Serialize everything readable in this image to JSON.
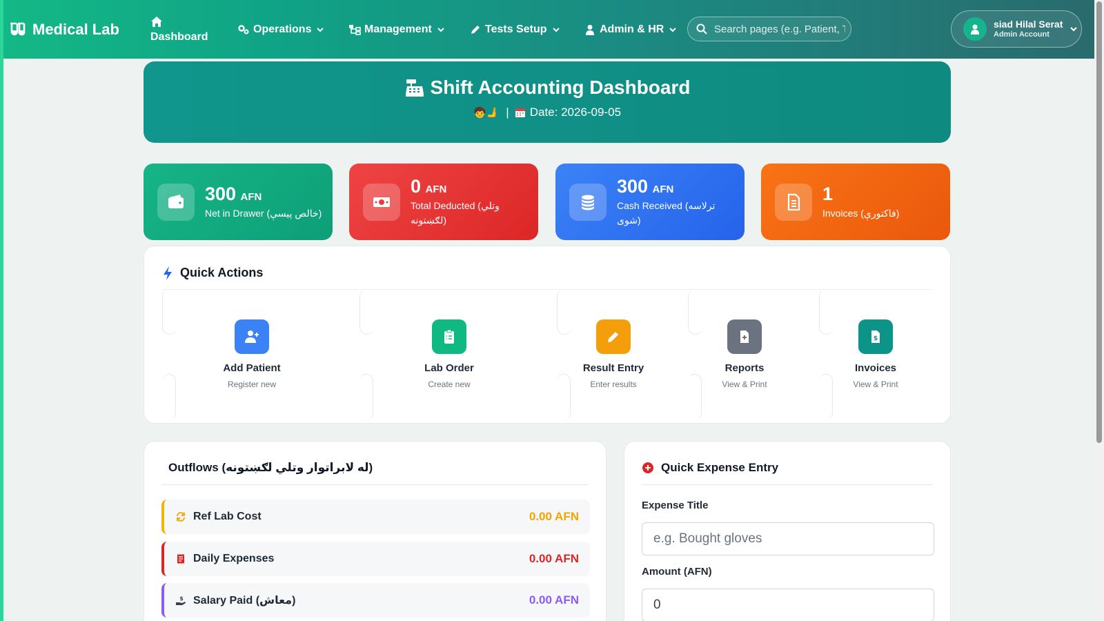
{
  "nav": {
    "brand": "Medical Lab",
    "home_label": "Dashboard",
    "items": [
      {
        "label": "Operations",
        "icon": "gears-icon"
      },
      {
        "label": "Management",
        "icon": "sitemap-icon"
      },
      {
        "label": "Tests Setup",
        "icon": "pen-icon"
      },
      {
        "label": "Admin & HR",
        "icon": "user-tie-icon"
      }
    ],
    "search_placeholder": "Search pages (e.g. Patient, T",
    "user": {
      "name": "siad Hilal Serat",
      "role": "Admin Account"
    }
  },
  "banner": {
    "title": "Shift Accounting Dashboard",
    "emoji": "🧒🫸",
    "separator": "|",
    "date": "Date: 2026-09-05"
  },
  "stats": [
    {
      "value": "300",
      "unit": "AFN",
      "label": "Net in Drawer (خالص پیسې)",
      "color": "#16b486",
      "icon": "wallet-icon"
    },
    {
      "value": "0",
      "unit": "AFN",
      "label": "Total Deducted (وتلي لګښتونه)",
      "color": "#ef4444",
      "icon": "money-bill-icon"
    },
    {
      "value": "300",
      "unit": "AFN",
      "label": "Cash Received (ترلاسه شوی)",
      "color": "#3b82f6",
      "icon": "coins-icon"
    },
    {
      "value": "1",
      "unit": "",
      "label": "Invoices (فاکتورې)",
      "color": "#f97316",
      "icon": "file-invoice-icon"
    }
  ],
  "quick_actions": {
    "title": "Quick Actions",
    "items": [
      {
        "title": "Add Patient",
        "sub": "Register new",
        "color": "#3b82f6",
        "icon": "user-plus-icon"
      },
      {
        "title": "Lab Order",
        "sub": "Create new",
        "color": "#10b981",
        "icon": "clipboard-list-icon"
      },
      {
        "title": "Result Entry",
        "sub": "Enter results",
        "color": "#f59e0b",
        "icon": "pen-icon"
      },
      {
        "title": "Reports",
        "sub": "View & Print",
        "color": "#6b7280",
        "icon": "file-medical-icon"
      },
      {
        "title": "Invoices",
        "sub": "View & Print",
        "color": "#0d9488",
        "icon": "file-invoice-dollar-icon"
      }
    ]
  },
  "outflows": {
    "title": "Outflows (له لابراتوار وتلي لګښتونه)",
    "rows": [
      {
        "label": "Ref Lab Cost",
        "amount": "0.00 AFN",
        "color": "#f4a300",
        "icon": "sync-icon"
      },
      {
        "label": "Daily Expenses",
        "amount": "0.00 AFN",
        "color": "#dc2626",
        "icon": "receipt-icon"
      },
      {
        "label": "Salary Paid (معاش)",
        "amount": "0.00 AFN",
        "color": "#8b5cf6",
        "icon": "hand-holding-dollar-icon"
      }
    ]
  },
  "expense": {
    "title": "Quick Expense Entry",
    "title_label": "Expense Title",
    "title_placeholder": "e.g. Bought gloves",
    "amount_label": "Amount (AFN)",
    "amount_value": "0"
  }
}
